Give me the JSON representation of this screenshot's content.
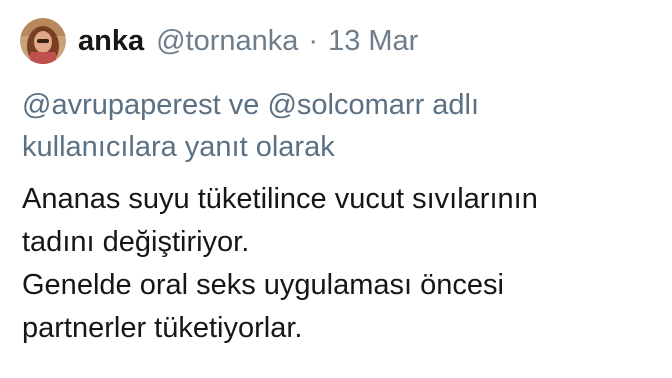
{
  "tweet": {
    "avatar_icon": "user-avatar-icon",
    "display_name": "anka",
    "handle": "@tornanka",
    "separator": "·",
    "date": "13 Mar",
    "reply_context": {
      "mention_1": "@avrupaperest",
      "connector": "ve",
      "mention_2": "@solcomarr",
      "suffix_line_1": "adlı",
      "suffix_line_2": "kullanıcılara yanıt olarak"
    },
    "body": [
      "Ananas suyu tüketilince vucut sıvılarının",
      "tadını değiştiriyor.",
      "Genelde oral seks uygulaması öncesi",
      "partnerler tüketiyorlar."
    ]
  },
  "colors": {
    "text_primary": "#14171a",
    "text_secondary": "#6e7d8c",
    "reply_context": "#5b7083",
    "background": "#ffffff"
  }
}
